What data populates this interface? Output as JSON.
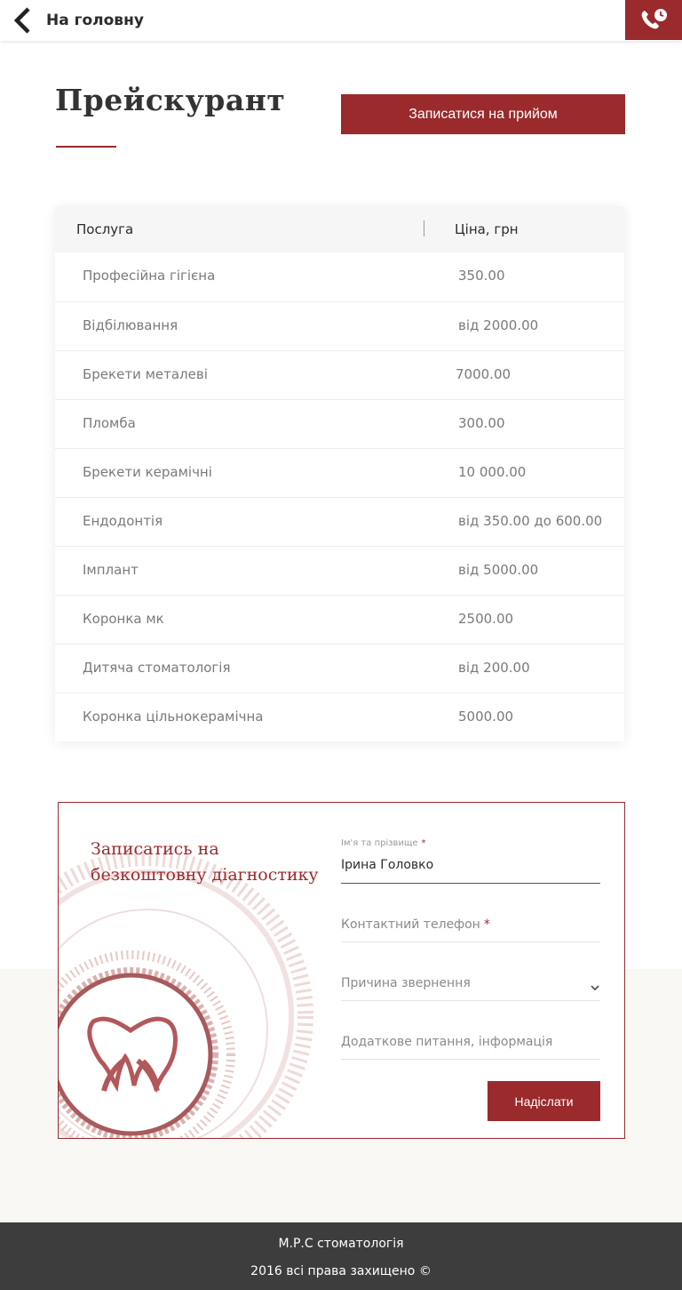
{
  "header": {
    "back_label": "На головну",
    "back_icon": "chevron-left-icon",
    "call_icon": "phone-clock-icon"
  },
  "page": {
    "title": "Прейскурант",
    "book_button": "Записатися на прийом"
  },
  "price_table": {
    "col_service": "Послуга",
    "col_price": "Ціна, грн",
    "rows": [
      {
        "service": "Професійна гігієна",
        "price": "350.00"
      },
      {
        "service": "Відбілювання",
        "price": "від 2000.00"
      },
      {
        "service": "Брекети металеві",
        "price": "7000.00"
      },
      {
        "service": "Пломба",
        "price": "300.00"
      },
      {
        "service": "Брекети керамічні",
        "price": "10 000.00"
      },
      {
        "service": "Ендодонтія",
        "price": "від 350.00 до 600.00"
      },
      {
        "service": "Імплант",
        "price": "від 5000.00"
      },
      {
        "service": "Коронка мк",
        "price": "2500.00"
      },
      {
        "service": "Дитяча стоматологія",
        "price": "від 200.00"
      },
      {
        "service": "Коронка цільнокерамічна",
        "price": "5000.00"
      }
    ]
  },
  "form": {
    "heading_line1": "Записатись на",
    "heading_line2": "безкоштовну діагностику",
    "name_label": "Ім'я та прізвище",
    "name_value": "Ірина Головко",
    "phone_placeholder": "Контактний телефон",
    "reason_placeholder": "Причина звернення",
    "extra_placeholder": "Додаткове питання, інформація",
    "required_mark": "*",
    "submit": "Надіслати",
    "logo_icon": "tooth-logo-icon"
  },
  "footer": {
    "line1": "М.Р.С стоматологія",
    "line2": "2016 всі права захищено ©"
  },
  "colors": {
    "accent": "#9a2a2c",
    "footer_bg": "#3d3d3d",
    "band_bg": "#faf8f5"
  }
}
